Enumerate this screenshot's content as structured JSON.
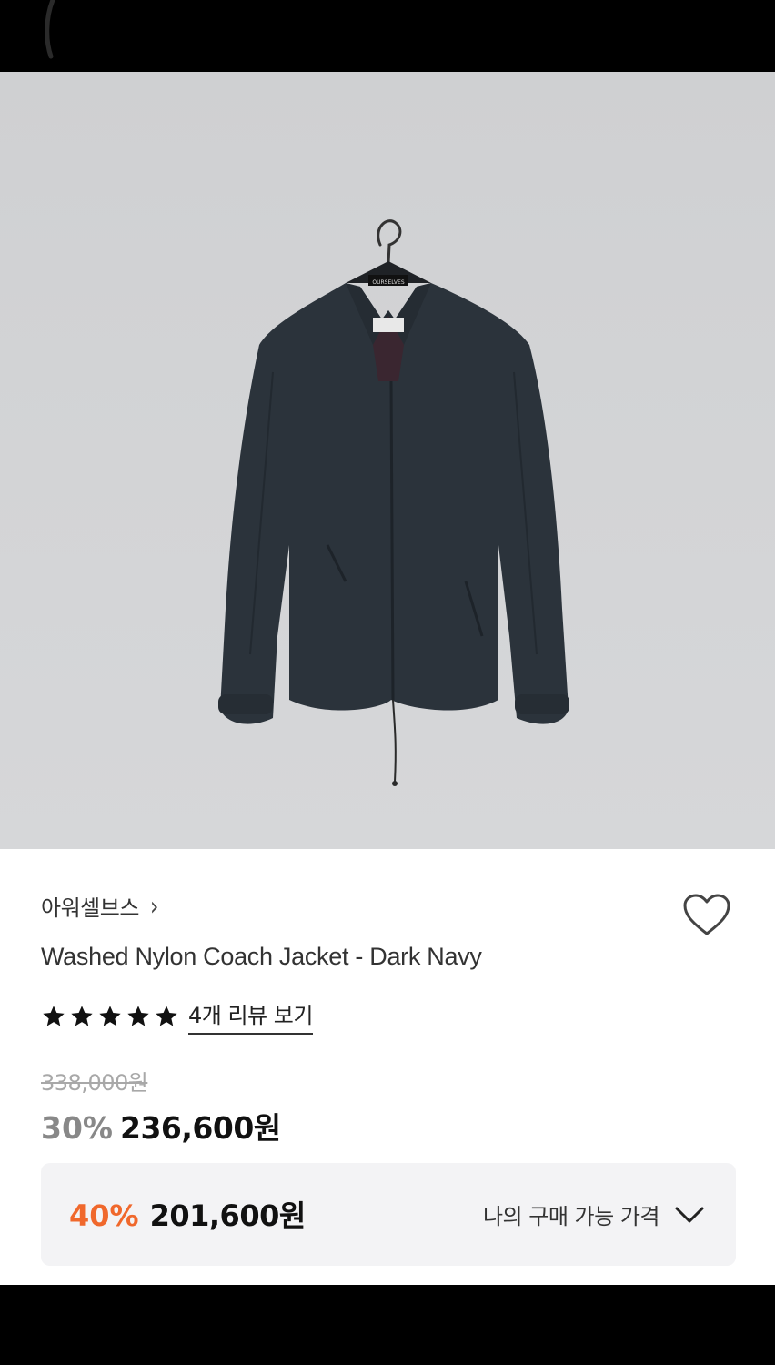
{
  "product": {
    "brand": "아워셀브스",
    "brand_chevron": "›",
    "title": "Washed Nylon Coach Jacket - Dark Navy",
    "rating_stars": 5,
    "review_link": "4개 리뷰 보기",
    "original_price": "338,000원",
    "discount_rate": "30%",
    "sale_price": "236,600원"
  },
  "my_price": {
    "rate": "40%",
    "price": "201,600원",
    "label": "나의 구매 가능 가격"
  },
  "icons": {
    "wishlist": "heart-outline-icon",
    "expand": "chevron-down-icon",
    "star": "star-icon"
  },
  "colors": {
    "accent": "#f0682c",
    "strike": "#a8a8a8",
    "discount_gray": "#888888",
    "jacket": "#2b333b"
  }
}
